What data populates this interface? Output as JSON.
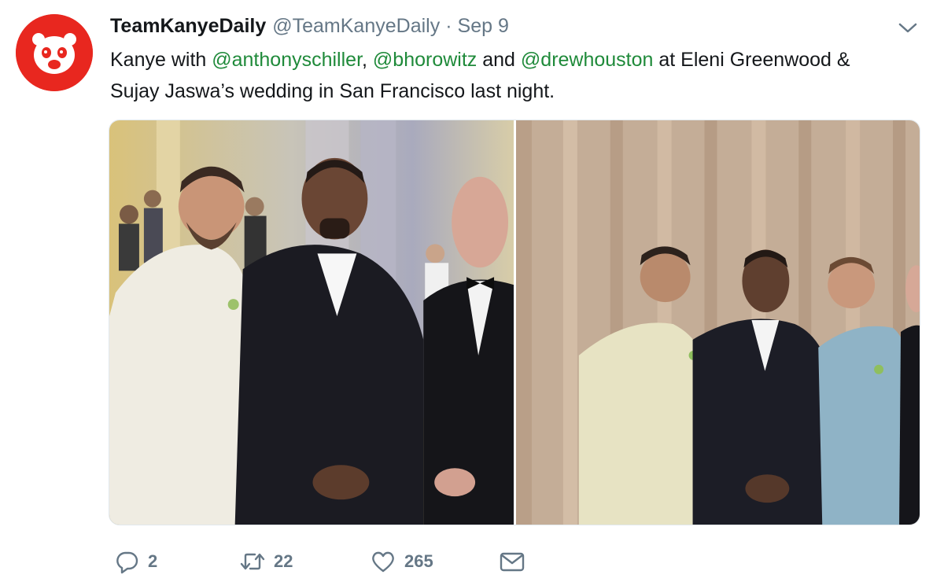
{
  "tweet": {
    "display_name": "TeamKanyeDaily",
    "handle": "@TeamKanyeDaily",
    "separator": "·",
    "date": "Sep 9",
    "text_1": "Kanye with ",
    "mention_1": "@anthonyschiller",
    "text_2": ", ",
    "mention_2": "@bhorowitz",
    "text_3": " and ",
    "mention_3": "@drewhouston",
    "text_4": " at Eleni Greenwood & Sujay Jaswa’s wedding in San Francisco last night."
  },
  "actions": {
    "replies": "2",
    "retweets": "22",
    "likes": "265"
  },
  "colors": {
    "avatar_bg": "#e8271f",
    "mention": "#1f8a3a",
    "muted": "#657786"
  },
  "icons": {
    "avatar": "bear-logo-icon",
    "menu": "chevron-down-icon",
    "reply": "reply-icon",
    "retweet": "retweet-icon",
    "like": "heart-icon",
    "dm": "envelope-icon"
  }
}
